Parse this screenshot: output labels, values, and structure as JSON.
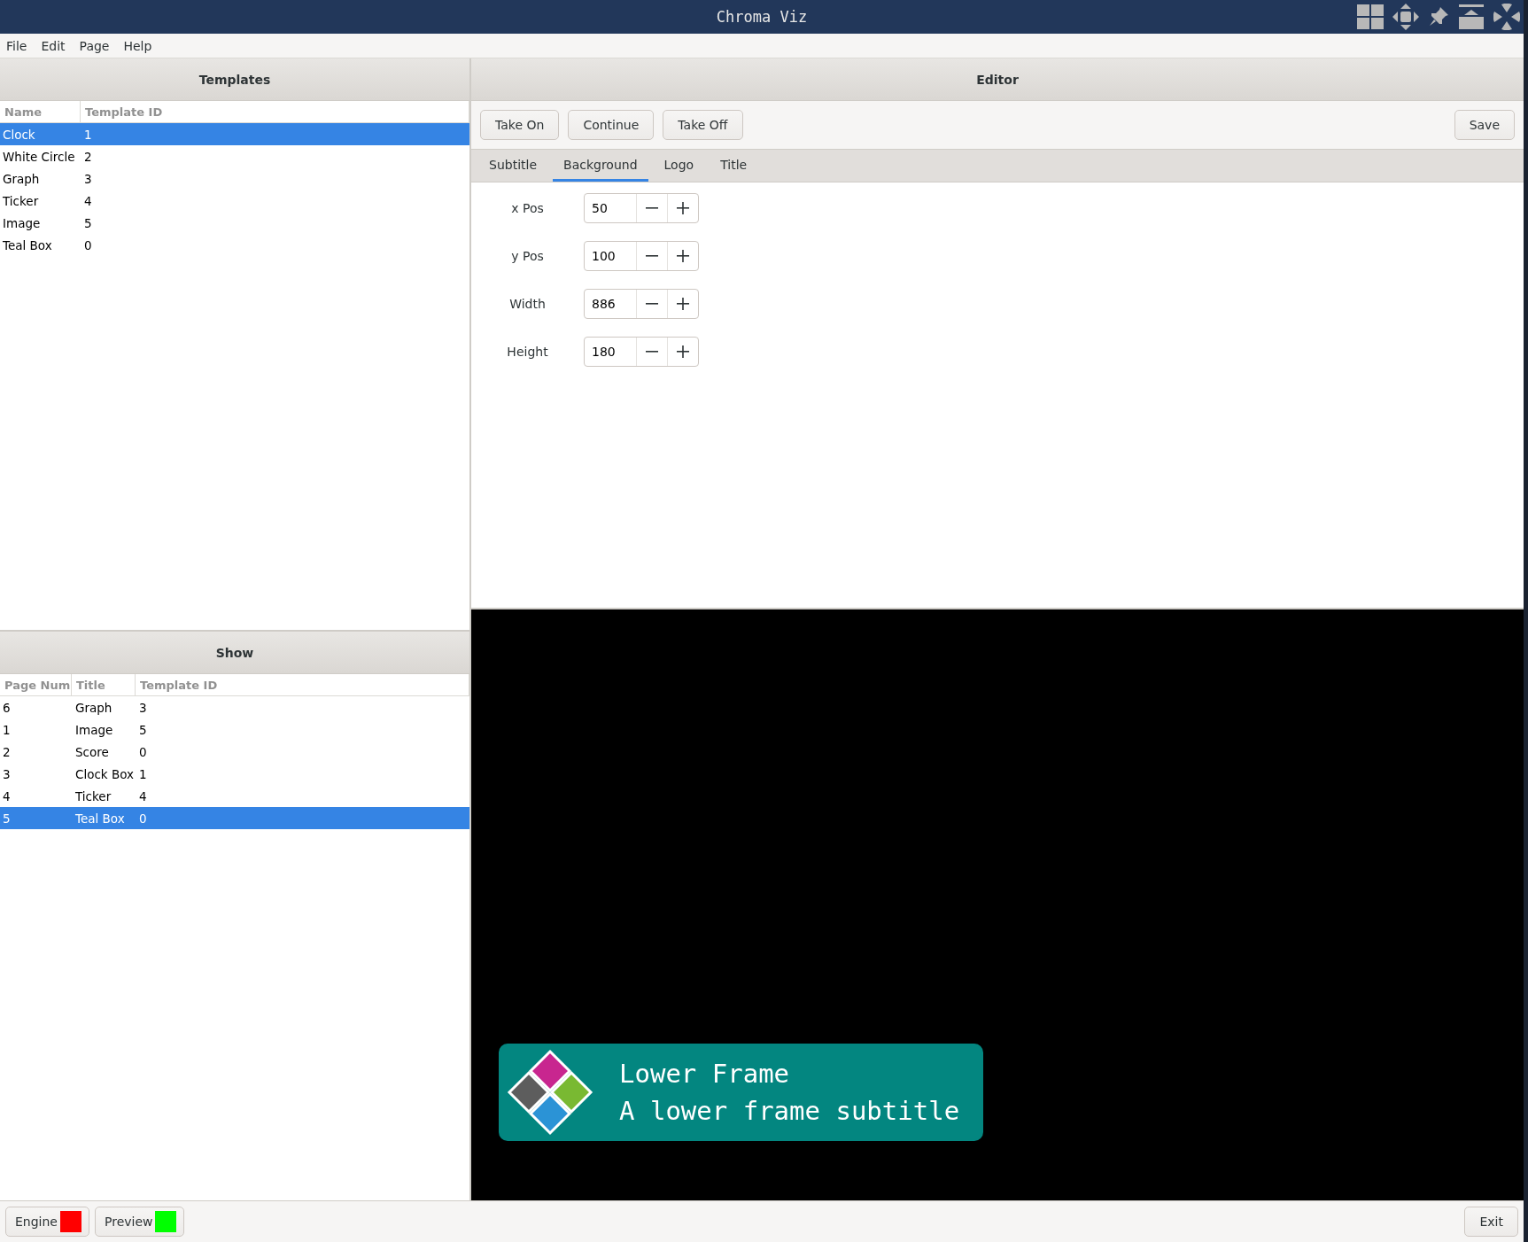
{
  "window": {
    "title": "Chroma Viz"
  },
  "menu": [
    "File",
    "Edit",
    "Page",
    "Help"
  ],
  "templates": {
    "title": "Templates",
    "columns": [
      "Name",
      "Template ID"
    ],
    "rows": [
      {
        "cells": [
          "Clock",
          "1"
        ],
        "selected": true
      },
      {
        "cells": [
          "White Circle",
          "2"
        ],
        "selected": false
      },
      {
        "cells": [
          "Graph",
          "3"
        ],
        "selected": false
      },
      {
        "cells": [
          "Ticker",
          "4"
        ],
        "selected": false
      },
      {
        "cells": [
          "Image",
          "5"
        ],
        "selected": false
      },
      {
        "cells": [
          "Teal Box",
          "0"
        ],
        "selected": false
      }
    ]
  },
  "show": {
    "title": "Show",
    "columns": [
      "Page Num",
      "Title",
      "Template ID"
    ],
    "rows": [
      {
        "cells": [
          "6",
          "Graph",
          "3"
        ],
        "selected": false
      },
      {
        "cells": [
          "1",
          "Image",
          "5"
        ],
        "selected": false
      },
      {
        "cells": [
          "2",
          "Score",
          "0"
        ],
        "selected": false
      },
      {
        "cells": [
          "3",
          "Clock Box",
          "1"
        ],
        "selected": false
      },
      {
        "cells": [
          "4",
          "Ticker",
          "4"
        ],
        "selected": false
      },
      {
        "cells": [
          "5",
          "Teal Box",
          "0"
        ],
        "selected": true
      }
    ]
  },
  "editor": {
    "title": "Editor",
    "actions": [
      "Take On",
      "Continue",
      "Take Off"
    ],
    "save": "Save",
    "tabs": [
      {
        "label": "Subtitle",
        "selected": false
      },
      {
        "label": "Background",
        "selected": true
      },
      {
        "label": "Logo",
        "selected": false
      },
      {
        "label": "Title",
        "selected": false
      }
    ],
    "fields": [
      {
        "label": "x Pos",
        "value": "50"
      },
      {
        "label": "y Pos",
        "value": "100"
      },
      {
        "label": "Width",
        "value": "886"
      },
      {
        "label": "Height",
        "value": "180"
      }
    ]
  },
  "preview": {
    "lower_frame": {
      "title": "Lower Frame",
      "subtitle": "A lower frame subtitle"
    }
  },
  "status": [
    {
      "label": "Engine",
      "color": "#ff0000"
    },
    {
      "label": "Preview",
      "color": "#00ff00"
    }
  ],
  "exit": "Exit"
}
